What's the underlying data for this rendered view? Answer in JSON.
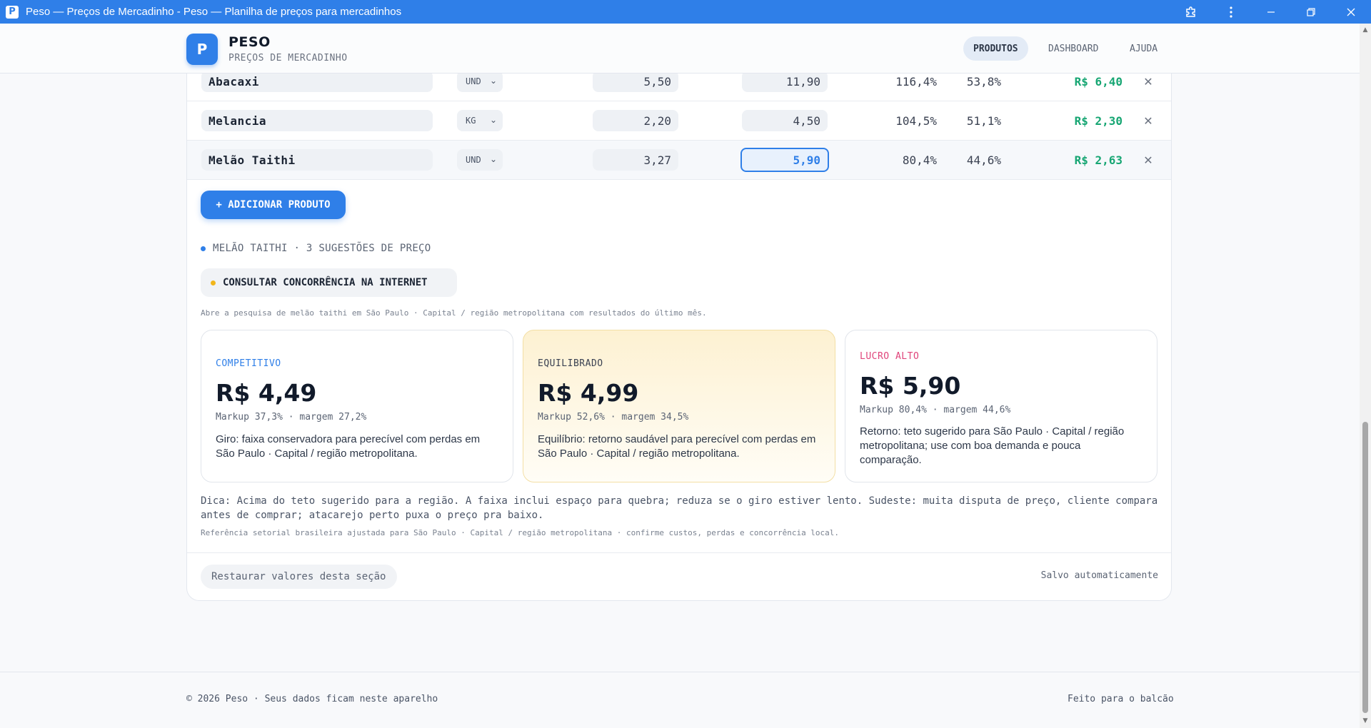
{
  "window": {
    "title": "Peso — Preços de Mercadinho - Peso — Planilha de preços para mercadinhos",
    "app_icon": "P",
    "icons": [
      "extension-icon",
      "menu-dots-icon",
      "minimize-icon",
      "restore-icon",
      "close-icon"
    ]
  },
  "header": {
    "logo_letter": "P",
    "brand_name": "PESO",
    "brand_subtitle": "PREÇOS DE MERCADINHO",
    "nav": [
      "PRODUTOS",
      "DASHBOARD",
      "AJUDA"
    ],
    "active_nav": "PRODUTOS",
    "accent_color": "#2f7fe8"
  },
  "products": [
    {
      "name": "Abacaxi",
      "unit": "UND",
      "cost": "5,50",
      "price": "11,90",
      "markup": "116,4%",
      "margin": "53,8%",
      "profit": "R$ 6,40"
    },
    {
      "name": "Melancia",
      "unit": "KG",
      "cost": "2,20",
      "price": "4,50",
      "markup": "104,5%",
      "margin": "51,1%",
      "profit": "R$ 2,30"
    },
    {
      "name": "Melão Taithi",
      "unit": "UND",
      "cost": "3,27",
      "price": "5,90",
      "markup": "80,4%",
      "margin": "44,6%",
      "profit": "R$ 2,63"
    }
  ],
  "add_button": "+ ADICIONAR PRODUTO",
  "suggestions": {
    "title": "MELÃO TAITHI · 3 SUGESTÕES DE PREÇO",
    "consult_button": "CONSULTAR CONCORRÊNCIA NA INTERNET",
    "consult_note": "Abre a pesquisa de melão taithi em São Paulo · Capital / região metropolitana com resultados do último mês.",
    "cards": [
      {
        "label": "COMPETITIVO",
        "price": "R$ 4,49",
        "stats": "Markup 37,3% · margem 27,2%",
        "desc": "Giro: faixa conservadora para perecível com perdas em São Paulo · Capital / região metropolitana.",
        "label_color": "#2f7fe8"
      },
      {
        "label": "EQUILIBRADO",
        "price": "R$ 4,99",
        "stats": "Markup 52,6% · margem 34,5%",
        "desc": "Equilíbrio: retorno saudável para perecível com perdas em São Paulo · Capital / região metropolitana.",
        "label_color": "#3b4252"
      },
      {
        "label": "LUCRO ALTO",
        "price": "R$ 5,90",
        "stats": "Markup 80,4% · margem 44,6%",
        "desc": "Retorno: teto sugerido para São Paulo · Capital / região metropolitana; use com boa demanda e pouca comparação.",
        "label_color": "#e0457b"
      }
    ],
    "tip": "Dica: Acima do teto sugerido para a região. A faixa inclui espaço para quebra; reduza se o giro estiver lento. Sudeste: muita disputa de preço, cliente compara antes de comprar; atacarejo perto puxa o preço pra baixo.",
    "reference": "Referência setorial brasileira ajustada para São Paulo · Capital / região metropolitana · confirme custos, perdas e concorrência local."
  },
  "card_footer": {
    "restore_button": "Restaurar valores desta seção",
    "saved_status": "Salvo automaticamente"
  },
  "page_footer": {
    "left": "© 2026 Peso · Seus dados ficam neste aparelho",
    "right": "Feito para o balcão"
  },
  "profit_color": "#17a673"
}
